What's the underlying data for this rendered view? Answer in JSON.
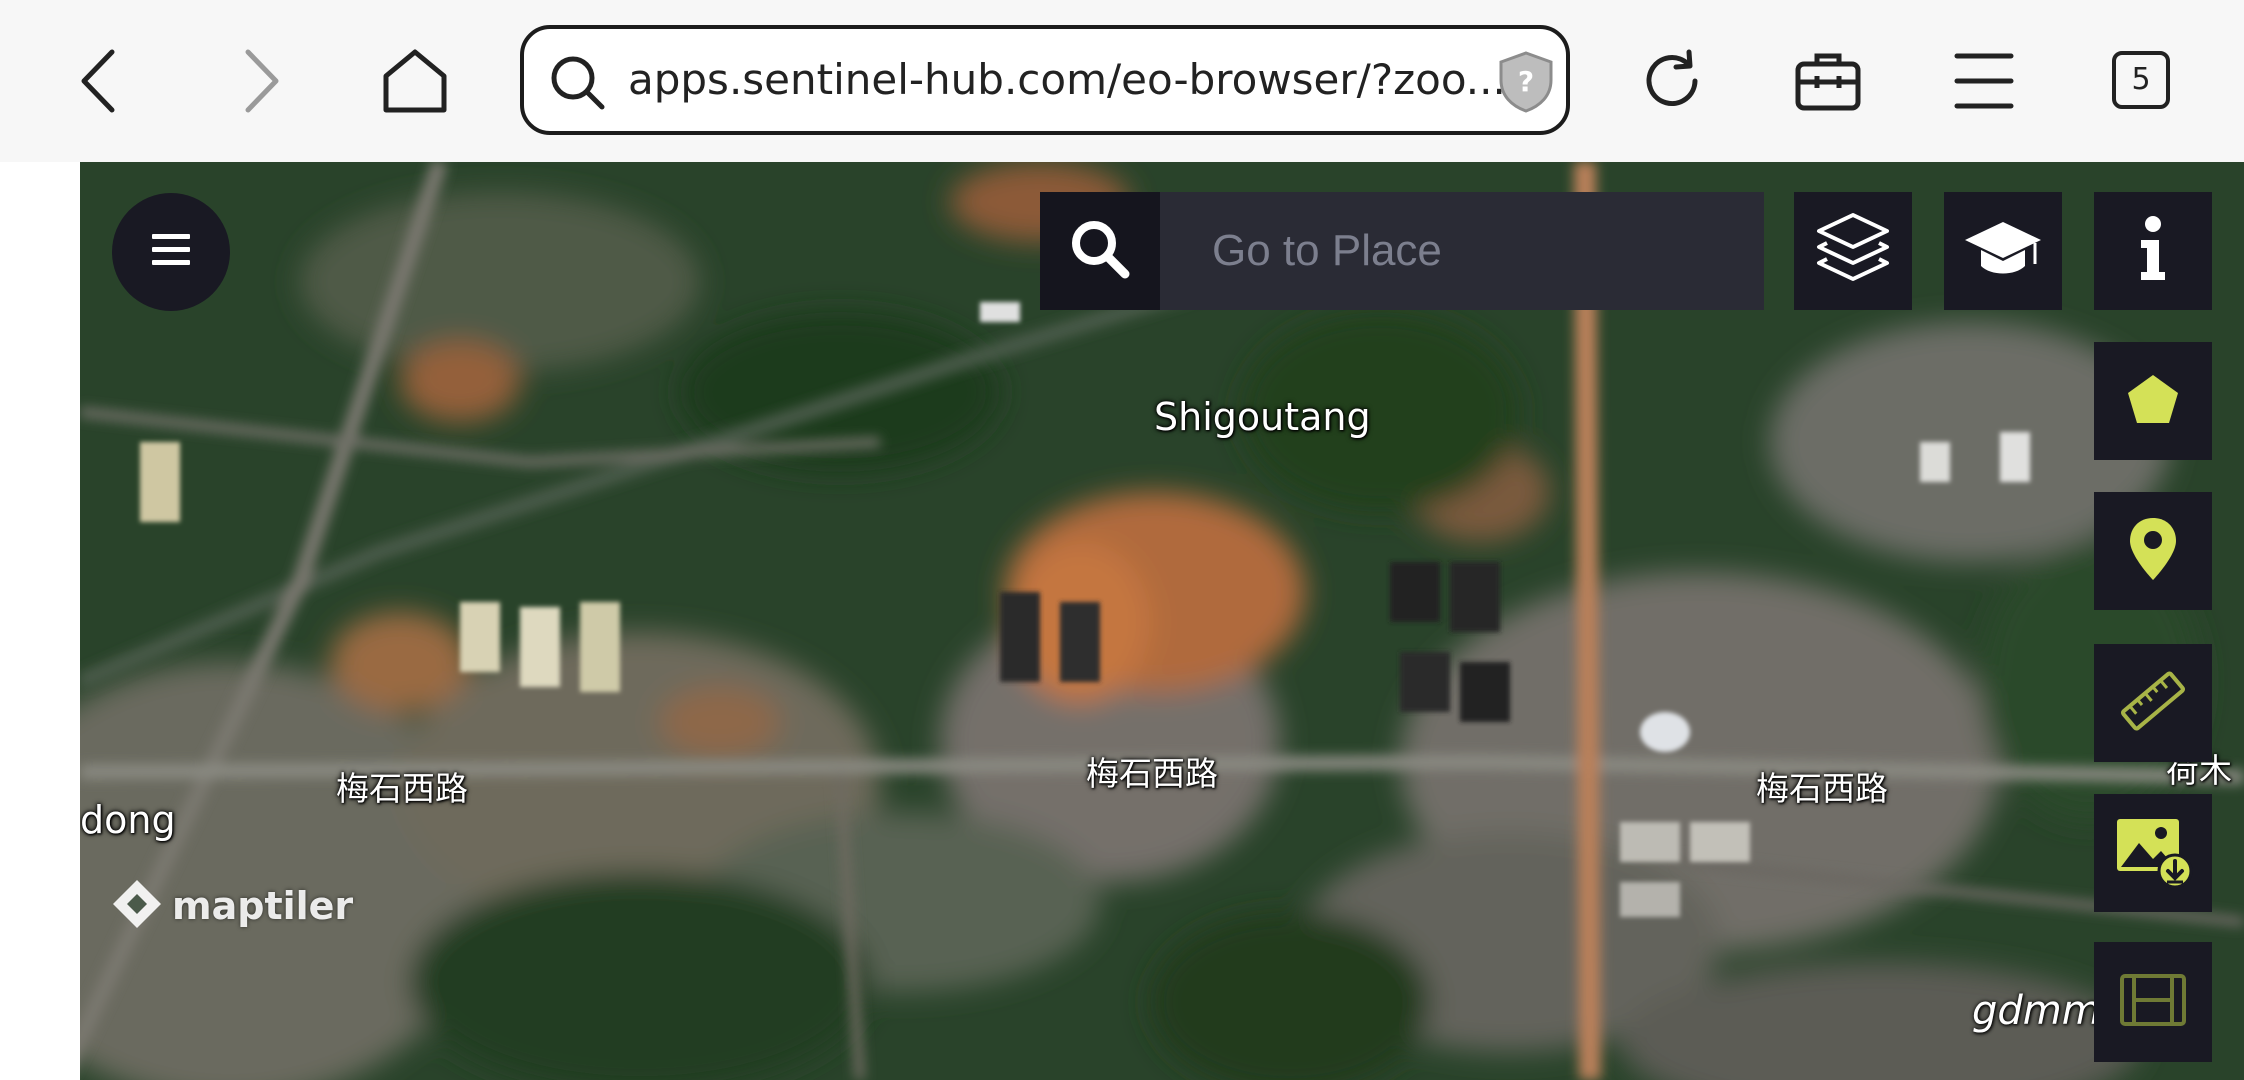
{
  "browser": {
    "url": "apps.sentinel-hub.com/eo-browser/?zoo...",
    "tab_count": "5",
    "icons": {
      "back": "chevron-left-icon",
      "forward": "chevron-right-icon",
      "home": "home-icon",
      "search": "search-icon",
      "shield": "shield-question-icon",
      "reload": "reload-icon",
      "toolbox": "briefcase-icon",
      "menu": "menu-icon"
    }
  },
  "eo_browser": {
    "search_placeholder": "Go to Place",
    "controls": [
      "layers-icon",
      "graduation-cap-icon",
      "info-icon",
      "pentagon-icon",
      "map-pin-icon",
      "ruler-icon",
      "image-download-icon",
      "film-icon"
    ],
    "accent_color": "#d4e157"
  },
  "map": {
    "labels": {
      "shigoutang": "Shigoutang",
      "road_left": "梅石西路",
      "road_center": "梅石西路",
      "road_right": "梅石西路",
      "edge_right": "荷木",
      "district_left": "dong"
    },
    "attribution": "maptiler",
    "watermark": "gdmm.com"
  }
}
